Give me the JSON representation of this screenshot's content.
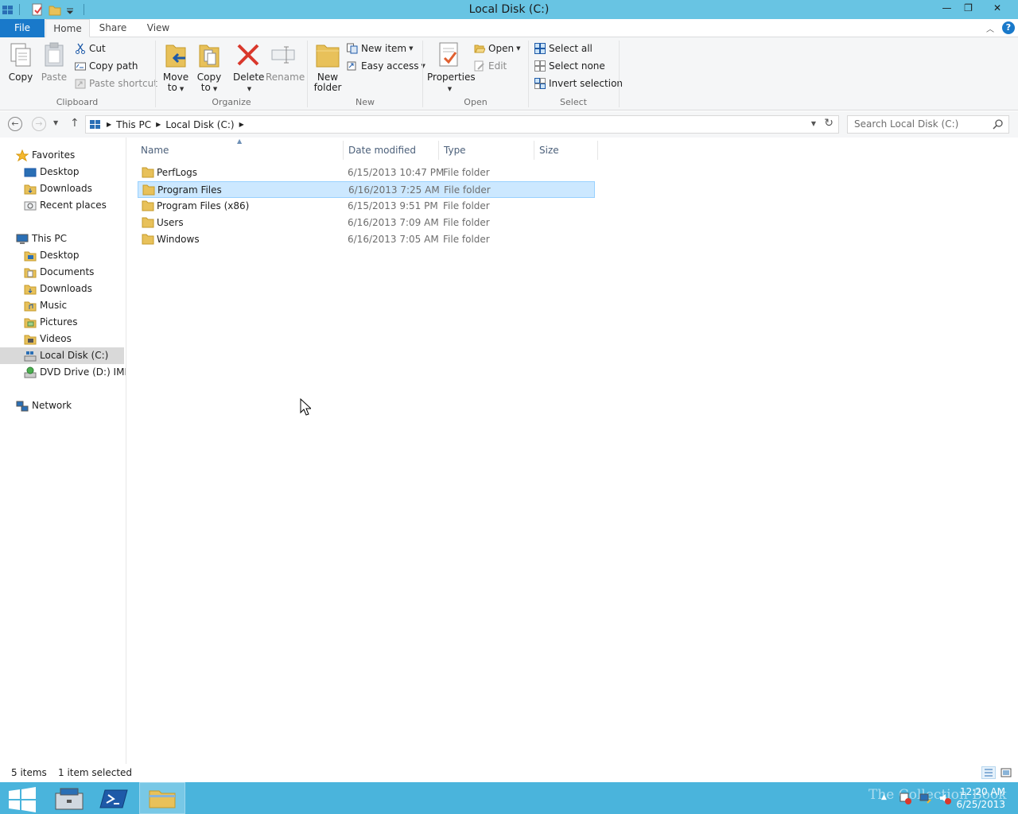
{
  "window": {
    "title": "Local Disk (C:)",
    "minimize": "—",
    "restore": "❐",
    "close": "✕"
  },
  "tabs": {
    "file": "File",
    "home": "Home",
    "share": "Share",
    "view": "View"
  },
  "ribbon": {
    "clipboard": {
      "label": "Clipboard",
      "copy": "Copy",
      "paste": "Paste",
      "cut": "Cut",
      "copy_path": "Copy path",
      "paste_shortcut": "Paste shortcut"
    },
    "organize": {
      "label": "Organize",
      "move_to_1": "Move",
      "move_to_2": "to",
      "copy_to_1": "Copy",
      "copy_to_2": "to",
      "delete": "Delete",
      "rename": "Rename"
    },
    "new": {
      "label": "New",
      "new_folder_1": "New",
      "new_folder_2": "folder",
      "new_item": "New item",
      "easy_access": "Easy access"
    },
    "open": {
      "label": "Open",
      "properties": "Properties",
      "open": "Open",
      "edit": "Edit"
    },
    "select": {
      "label": "Select",
      "select_all": "Select all",
      "select_none": "Select none",
      "invert_selection": "Invert selection"
    }
  },
  "address": {
    "crumbs": [
      "This PC",
      "Local Disk (C:)"
    ],
    "search_placeholder": "Search Local Disk (C:)"
  },
  "navpane": {
    "favorites": "Favorites",
    "favorites_items": [
      "Desktop",
      "Downloads",
      "Recent places"
    ],
    "this_pc": "This PC",
    "this_pc_items": [
      "Desktop",
      "Documents",
      "Downloads",
      "Music",
      "Pictures",
      "Videos",
      "Local Disk (C:)",
      "DVD Drive (D:) IMP_S"
    ],
    "network": "Network"
  },
  "columns": {
    "name": "Name",
    "date": "Date modified",
    "type": "Type",
    "size": "Size"
  },
  "files": [
    {
      "name": "PerfLogs",
      "date": "6/15/2013 10:47 PM",
      "type": "File folder"
    },
    {
      "name": "Program Files",
      "date": "6/16/2013 7:25 AM",
      "type": "File folder"
    },
    {
      "name": "Program Files (x86)",
      "date": "6/15/2013 9:51 PM",
      "type": "File folder"
    },
    {
      "name": "Users",
      "date": "6/16/2013 7:09 AM",
      "type": "File folder"
    },
    {
      "name": "Windows",
      "date": "6/16/2013 7:05 AM",
      "type": "File folder"
    }
  ],
  "status": {
    "count": "5 items",
    "selected": "1 item selected"
  },
  "taskbar": {
    "time": "12:20 AM",
    "date": "6/25/2013",
    "watermark": "The Collection Book"
  },
  "colors": {
    "titlebar": "#68c4e3",
    "file_tab": "#1979ca",
    "selection": "#cce8ff",
    "taskbar": "#4ab4dc",
    "folder": "#e8c15a"
  }
}
